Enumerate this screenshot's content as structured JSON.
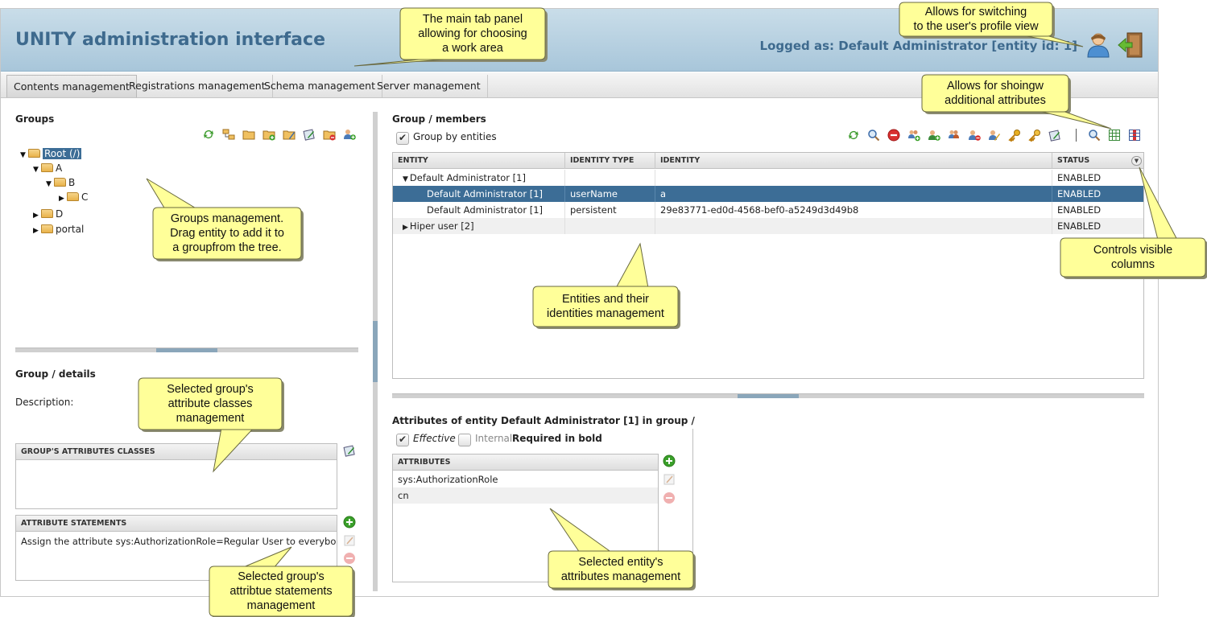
{
  "header": {
    "app_title": "UNITY administration interface",
    "logged_as": "Logged as: Default Administrator [entity id: 1]",
    "profile_icon": "user-profile-icon",
    "logout_icon": "logout-door-icon"
  },
  "tabs": [
    {
      "label": "Contents management",
      "active": true
    },
    {
      "label": "Registrations management",
      "active": false
    },
    {
      "label": "Schema management",
      "active": false
    },
    {
      "label": "Server management",
      "active": false
    }
  ],
  "groups": {
    "title": "Groups",
    "toolbar_icons": [
      "refresh-icon",
      "group-tree-icon",
      "folder-icon",
      "folder-add-icon",
      "folder-edit-icon",
      "attribute-class-icon",
      "folder-delete-icon",
      "add-entity-icon"
    ],
    "tree": [
      {
        "label": "Root (/)",
        "depth": 0,
        "expanded": true,
        "selected": true
      },
      {
        "label": "A",
        "depth": 1,
        "expanded": true
      },
      {
        "label": "B",
        "depth": 2,
        "expanded": true
      },
      {
        "label": "C",
        "depth": 3,
        "expanded": false
      },
      {
        "label": "D",
        "depth": 1,
        "expanded": false
      },
      {
        "label": "portal",
        "depth": 1,
        "expanded": false
      }
    ]
  },
  "group_details": {
    "title": "Group / details",
    "description_label": "Description:",
    "attr_classes_header": "GROUP'S ATTRIBUTES CLASSES",
    "attr_statements_header": "ATTRIBUTE STATEMENTS",
    "statements": [
      "Assign the attribute sys:AuthorizationRole=Regular User to everybody"
    ]
  },
  "members": {
    "title": "Group / members",
    "group_by_label": "Group by entities",
    "group_by_checked": true,
    "toolbar_icons": [
      "refresh-icon",
      "search-icon",
      "remove-icon",
      "add-entity-icon",
      "add-identity-icon",
      "add-to-group-icon",
      "remove-from-group-icon",
      "change-status-icon",
      "credential-key-icon",
      "credential-key-alt-icon",
      "edit-attribute-class-icon",
      "show-search-icon",
      "additional-attributes-icon",
      "visible-columns-icon"
    ],
    "columns": [
      "ENTITY",
      "IDENTITY TYPE",
      "IDENTITY",
      "STATUS"
    ],
    "rows": [
      {
        "entity": "Default Administrator [1]",
        "type": "",
        "identity": "",
        "status": "ENABLED",
        "expander": "▼",
        "indent": 0,
        "selected": false
      },
      {
        "entity": "Default Administrator [1]",
        "type": "userName",
        "identity": "a",
        "status": "ENABLED",
        "expander": "",
        "indent": 1,
        "selected": true
      },
      {
        "entity": "Default Administrator [1]",
        "type": "persistent",
        "identity": "29e83771-ed0d-4568-bef0-a5249d3d49b8",
        "status": "ENABLED",
        "expander": "",
        "indent": 1,
        "selected": false
      },
      {
        "entity": "Hiper user [2]",
        "type": "",
        "identity": "",
        "status": "ENABLED",
        "expander": "▶",
        "indent": 0,
        "selected": false
      }
    ]
  },
  "attributes": {
    "title": "Attributes of entity Default Administrator [1] in group /",
    "effective_label": "Effective",
    "internal_label": "Internal",
    "required_note": "Required in bold",
    "column": "ATTRIBUTES",
    "items": [
      "sys:AuthorizationRole",
      "cn"
    ]
  },
  "callouts": {
    "tab_panel": "The main tab panel\nallowing for choosing\na work area",
    "profile": "Allows for switching\nto the user's profile view",
    "additional_attrs": "Allows for shoingw\nadditional attributes",
    "groups_mgmt": "Groups management.\nDrag entity to add it to\na groupfrom the tree.",
    "columns": "Controls visible\ncolumns",
    "entities": "Entities and their\nidentities management",
    "attr_classes": "Selected group's\nattribute classes\nmanagement",
    "statements": "Selected group's\nattribtue statements\nmanagement",
    "entity_attrs": "Selected entity's\nattributes management"
  },
  "colors": {
    "header_blue": "#3e6a8e",
    "selection": "#3c6d96",
    "callout_fill": "#ffff99"
  }
}
